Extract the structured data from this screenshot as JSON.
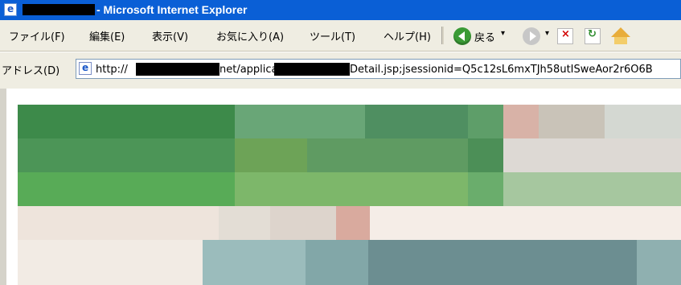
{
  "window": {
    "title": "- Microsoft Internet Explorer",
    "title_icon": "internet-explorer-icon"
  },
  "menu": {
    "items": [
      {
        "label": "ファイル(F)"
      },
      {
        "label": "編集(E)"
      },
      {
        "label": "表示(V)"
      },
      {
        "label": "お気に入り(A)"
      },
      {
        "label": "ツール(T)"
      },
      {
        "label": "ヘルプ(H)"
      }
    ],
    "toolbar": {
      "back_label": "戻る",
      "drop_symbol": "▾"
    }
  },
  "address": {
    "label": "アドレス(D)",
    "url_prefix": "http://",
    "url_middle": "net/application/",
    "url_suffix": "Detail.jsp;jsessionid=Q5c12sL6mxTJh58utISweAor2r6O6B"
  },
  "colors": {
    "title_bar": "#0a5fd6",
    "chrome": "#efede2",
    "highlight": "#ff0000",
    "redaction": "#000000"
  },
  "icons": {
    "back": "back-arrow-icon",
    "forward": "forward-arrow-icon",
    "stop": "stop-icon",
    "refresh": "refresh-icon",
    "home": "home-icon"
  }
}
